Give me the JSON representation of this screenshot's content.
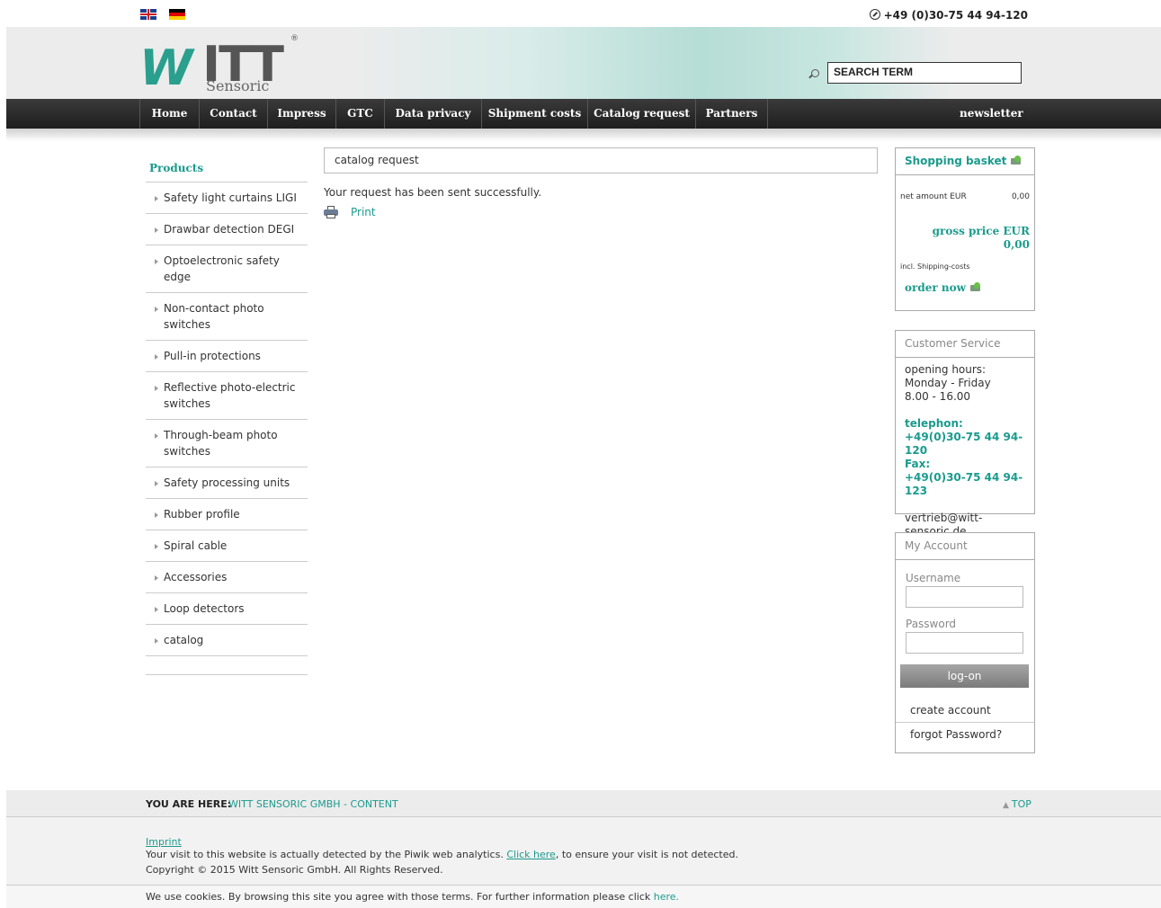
{
  "top": {
    "phone": "+49 (0)30-75 44 94-120"
  },
  "logo": {
    "brand_w": "W",
    "brand_rest": "ITT",
    "registered": "®",
    "sub": "Sensoric"
  },
  "search": {
    "value": "SEARCH TERM"
  },
  "nav": {
    "items": [
      {
        "label": "Home"
      },
      {
        "label": "Contact"
      },
      {
        "label": "Impress"
      },
      {
        "label": "GTC"
      },
      {
        "label": "Data privacy"
      },
      {
        "label": "Shipment costs"
      },
      {
        "label": "Catalog request"
      },
      {
        "label": "Partners"
      }
    ],
    "newsletter": "newsletter"
  },
  "sidebar": {
    "title": "Products",
    "items": [
      {
        "label": "Safety light curtains LIGI"
      },
      {
        "label": "Drawbar detection DEGI"
      },
      {
        "label": "Optoelectronic safety edge"
      },
      {
        "label": "Non-contact photo switches"
      },
      {
        "label": "Pull-in protections"
      },
      {
        "label": "Reflective photo-electric switches"
      },
      {
        "label": "Through-beam photo switches"
      },
      {
        "label": "Safety processing units"
      },
      {
        "label": "Rubber profile"
      },
      {
        "label": "Spiral cable"
      },
      {
        "label": "Accessories"
      },
      {
        "label": "Loop detectors"
      },
      {
        "label": "catalog"
      }
    ]
  },
  "main": {
    "title": "catalog request",
    "message": "Your request has been sent successfully.",
    "print": "Print"
  },
  "basket": {
    "title": "Shopping basket",
    "net_label": "net amount EUR",
    "net_value": "0,00",
    "gross_label": "gross price EUR",
    "gross_value": "0,00",
    "incl": "incl. Shipping-costs",
    "order_now": "order now"
  },
  "customer_service": {
    "title": "Customer Service",
    "hours_label": "opening hours:",
    "days": "Monday - Friday",
    "time": "8.00 - 16.00",
    "telephon_label": "telephon:",
    "telephon": "+49(0)30-75 44 94-120",
    "fax_label": "Fax:",
    "fax": "+49(0)30-75 44 94-123",
    "email": "vertrieb@witt-sensoric.de"
  },
  "account": {
    "title": "My Account",
    "username_label": "Username",
    "password_label": "Password",
    "logon": "log-on",
    "create": "create account",
    "forgot": "forgot Password?"
  },
  "footer": {
    "you_are_here": "YOU ARE HERE:",
    "crumb": "WITT SENSORIC GMBH - CONTENT",
    "top": "TOP",
    "imprint": "Imprint",
    "piwik_before": "Your visit to this website is actually detected by the Piwik web analytics.",
    "piwik_link": "Click here",
    "piwik_after": ", to ensure your visit is not detected.",
    "copyright": "Copyright © 2015 Witt Sensoric GmbH. All Rights Reserved.",
    "cookie_text": "We use cookies. By browsing this site you agree with those terms. For further information please click",
    "cookie_link": "here."
  }
}
